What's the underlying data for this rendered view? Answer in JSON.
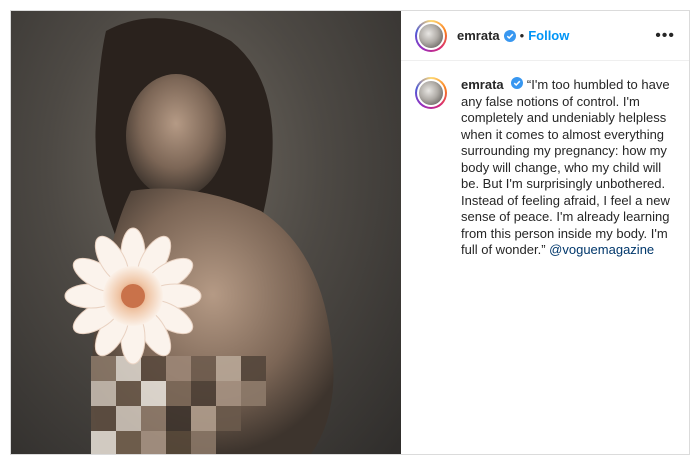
{
  "post": {
    "username": "emrata",
    "separator": "•",
    "follow_label": "Follow",
    "more_label": "•••",
    "caption": "“I'm too humbled to have any false notions of control. I'm completely and undeniably helpless when it comes to almost everything surrounding my pregnancy: how my body will change, who my child will be. But I'm surprisingly unbothered. Instead of feeling afraid, I feel a new sense of peace. I'm already learning from this person inside my body. I'm full of wonder.”",
    "mention": "@voguemagazine"
  },
  "colors": {
    "follow": "#0095f6",
    "verified": "#3897f0",
    "mention": "#00376b"
  },
  "icons": {
    "verified": "verified-badge-icon",
    "flower": "dahlia-flower",
    "more": "more-options-icon"
  }
}
